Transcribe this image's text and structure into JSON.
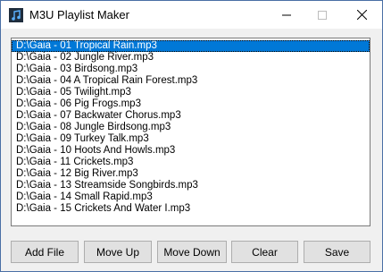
{
  "window": {
    "title": "M3U Playlist Maker",
    "controls": {
      "minimize": "—",
      "maximize": "☐",
      "close": "✕"
    }
  },
  "playlist": {
    "selected_index": 0,
    "items": [
      "D:\\Gaia - 01 Tropical Rain.mp3",
      "D:\\Gaia - 02 Jungle River.mp3",
      "D:\\Gaia - 03 Birdsong.mp3",
      "D:\\Gaia - 04 A Tropical Rain Forest.mp3",
      "D:\\Gaia - 05 Twilight.mp3",
      "D:\\Gaia - 06 Pig Frogs.mp3",
      "D:\\Gaia - 07 Backwater Chorus.mp3",
      "D:\\Gaia - 08 Jungle Birdsong.mp3",
      "D:\\Gaia - 09 Turkey Talk.mp3",
      "D:\\Gaia - 10 Hoots And Howls.mp3",
      "D:\\Gaia - 11 Crickets.mp3",
      "D:\\Gaia - 12 Big River.mp3",
      "D:\\Gaia - 13 Streamside Songbirds.mp3",
      "D:\\Gaia - 14 Small Rapid.mp3",
      "D:\\Gaia - 15 Crickets And Water I.mp3"
    ]
  },
  "buttons": {
    "add_file": "Add File",
    "move_up": "Move Up",
    "move_down": "Move Down",
    "clear": "Clear",
    "save": "Save"
  },
  "colors": {
    "selection": "#0078d7",
    "button_face": "#e1e1e1"
  },
  "icons": {
    "app": "music-note-icon"
  }
}
